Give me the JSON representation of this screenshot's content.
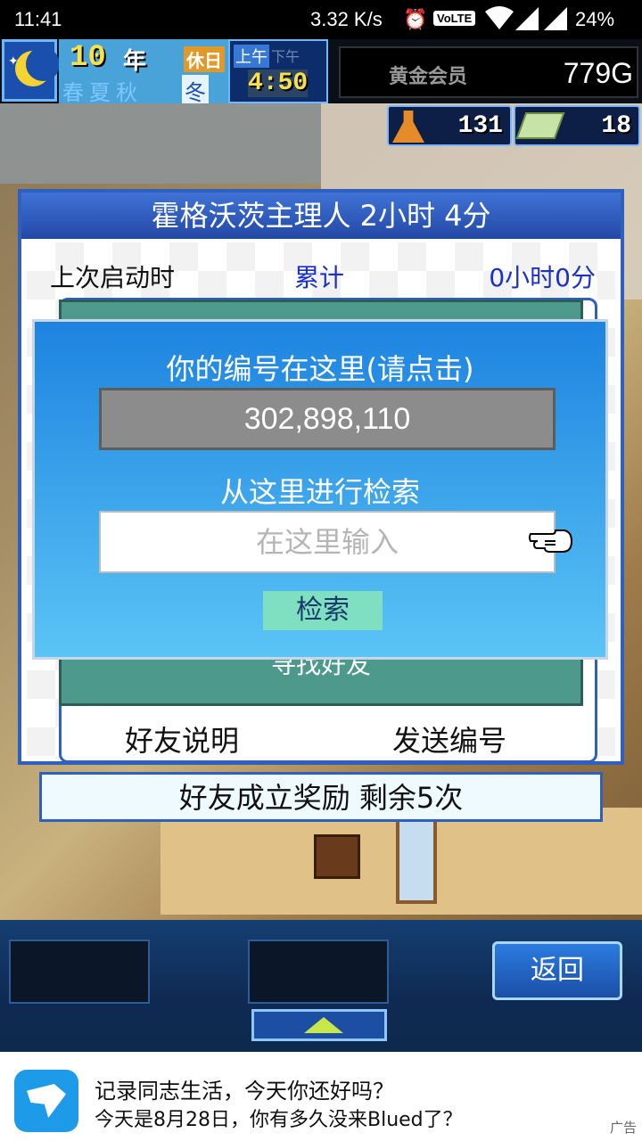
{
  "status_bar": {
    "time": "11:41",
    "network_speed": "3.32 K/s",
    "volte": "VoLTE",
    "battery": "24%"
  },
  "hud": {
    "year_number": "10",
    "year_label": "年",
    "holiday": "休日",
    "seasons": "春夏秋",
    "current_season": "冬",
    "am": "上午",
    "pm": "下午",
    "clock": "4:50",
    "gold_member": "黄金会员",
    "gold_amount": "779G"
  },
  "resources": {
    "research_points": "131",
    "tickets": "18"
  },
  "panel": {
    "title": "霍格沃茨主理人  2小时 4分",
    "last_launch_label": "上次启动时",
    "total_label": "累计",
    "total_value": "0小时0分",
    "find_friend": "寻找好友",
    "friend_help_button": "好友说明",
    "send_id_button": "发送编号"
  },
  "reward_bar": {
    "text": "好友成立奖励  剩余5次"
  },
  "dialog": {
    "title": "你的编号在这里(请点击)",
    "player_id": "302,898,110",
    "search_title": "从这里进行检索",
    "search_placeholder": "在这里输入",
    "search_button": "检索"
  },
  "bottom_bar": {
    "back_button": "返回"
  },
  "ad": {
    "line1": "记录同志生活，今天你还好吗？",
    "line2": "今天是8月28日，你有多久没来Blued了？",
    "tag": "广告"
  },
  "colors": {
    "panel_border": "#2f5fbf",
    "dialog_top": "#1d83e0",
    "dialog_bottom": "#5bc4f5",
    "search_button": "#7ee0c0",
    "total_text": "#1b2fd0"
  }
}
